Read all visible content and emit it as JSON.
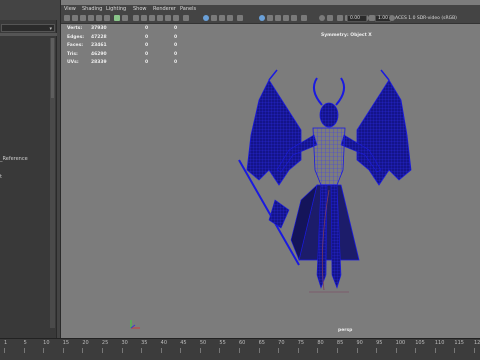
{
  "viewport_menu": [
    "View",
    "Shading",
    "Lighting",
    "Show",
    "Renderer",
    "Panels"
  ],
  "toolbar": {
    "exposure_value": "0.00",
    "gamma_value": "1.00",
    "color_space": "ACES 1.0 SDR-video (sRGB)"
  },
  "hud": {
    "rows": [
      {
        "label": "Verts:",
        "total": "37930",
        "sel1": "0",
        "sel2": "0"
      },
      {
        "label": "Edges:",
        "total": "47228",
        "sel1": "0",
        "sel2": "0"
      },
      {
        "label": "Faces:",
        "total": "23461",
        "sel1": "0",
        "sel2": "0"
      },
      {
        "label": "Tris:",
        "total": "46290",
        "sel1": "0",
        "sel2": "0"
      },
      {
        "label": "UVs:",
        "total": "28339",
        "sel1": "0",
        "sel2": "0"
      }
    ],
    "symmetry": "Symmetry: Object X",
    "camera": "persp"
  },
  "outliner": {
    "items": [
      "_Reference",
      "t"
    ]
  },
  "timeline": {
    "ticks": [
      "1",
      "5",
      "10",
      "15",
      "20",
      "25",
      "30",
      "35",
      "40",
      "45",
      "50",
      "55",
      "60",
      "65",
      "70",
      "75",
      "80",
      "85",
      "90",
      "95",
      "100",
      "105",
      "110",
      "115",
      "120"
    ]
  },
  "colors": {
    "viewport_bg": "#7c7c7c",
    "wireframe": "#1a1ae0",
    "accent": "#6aa0d8"
  }
}
